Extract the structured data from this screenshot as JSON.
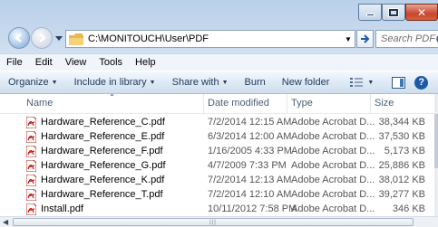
{
  "window": {
    "caption": {
      "close_glyph": "✕"
    },
    "address_path": "C:\\MONITOUCH\\User\\PDF",
    "search_placeholder": "Search PDF"
  },
  "menubar": [
    "File",
    "Edit",
    "View",
    "Tools",
    "Help"
  ],
  "commands": {
    "organize": "Organize",
    "include": "Include in library",
    "share": "Share with",
    "burn": "Burn",
    "new_folder": "New folder"
  },
  "columns": {
    "name": "Name",
    "date": "Date modified",
    "type": "Type",
    "size": "Size"
  },
  "files": [
    {
      "name": "Hardware_Reference_C.pdf",
      "date": "7/2/2014 12:15 AM",
      "type": "Adobe Acrobat D...",
      "size": "38,344 KB"
    },
    {
      "name": "Hardware_Reference_E.pdf",
      "date": "6/3/2014 12:00 AM",
      "type": "Adobe Acrobat D...",
      "size": "37,530 KB"
    },
    {
      "name": "Hardware_Reference_F.pdf",
      "date": "1/16/2005 4:33 PM",
      "type": "Adobe Acrobat D...",
      "size": "5,173 KB"
    },
    {
      "name": "Hardware_Reference_G.pdf",
      "date": "4/7/2009 7:33 PM",
      "type": "Adobe Acrobat D...",
      "size": "25,886 KB"
    },
    {
      "name": "Hardware_Reference_K.pdf",
      "date": "7/2/2014 12:13 AM",
      "type": "Adobe Acrobat D...",
      "size": "38,012 KB"
    },
    {
      "name": "Hardware_Reference_T.pdf",
      "date": "7/2/2014 12:10 AM",
      "type": "Adobe Acrobat D...",
      "size": "39,277 KB"
    },
    {
      "name": "Install.pdf",
      "date": "10/11/2012 7:58 PM",
      "type": "Adobe Acrobat D...",
      "size": "346 KB"
    }
  ],
  "icons": {
    "back": "back-arrow-icon",
    "forward": "forward-arrow-icon",
    "folder": "folder-icon",
    "refresh": "refresh-arrow-icon",
    "search": "search-icon",
    "pdf": "pdf-file-icon",
    "views": "views-icon",
    "preview_pane": "preview-pane-icon",
    "help": "help-icon"
  },
  "colors": {
    "window_frame": "#b9d1ea",
    "close_button": "#c9462c",
    "accent": "#1e395b"
  }
}
